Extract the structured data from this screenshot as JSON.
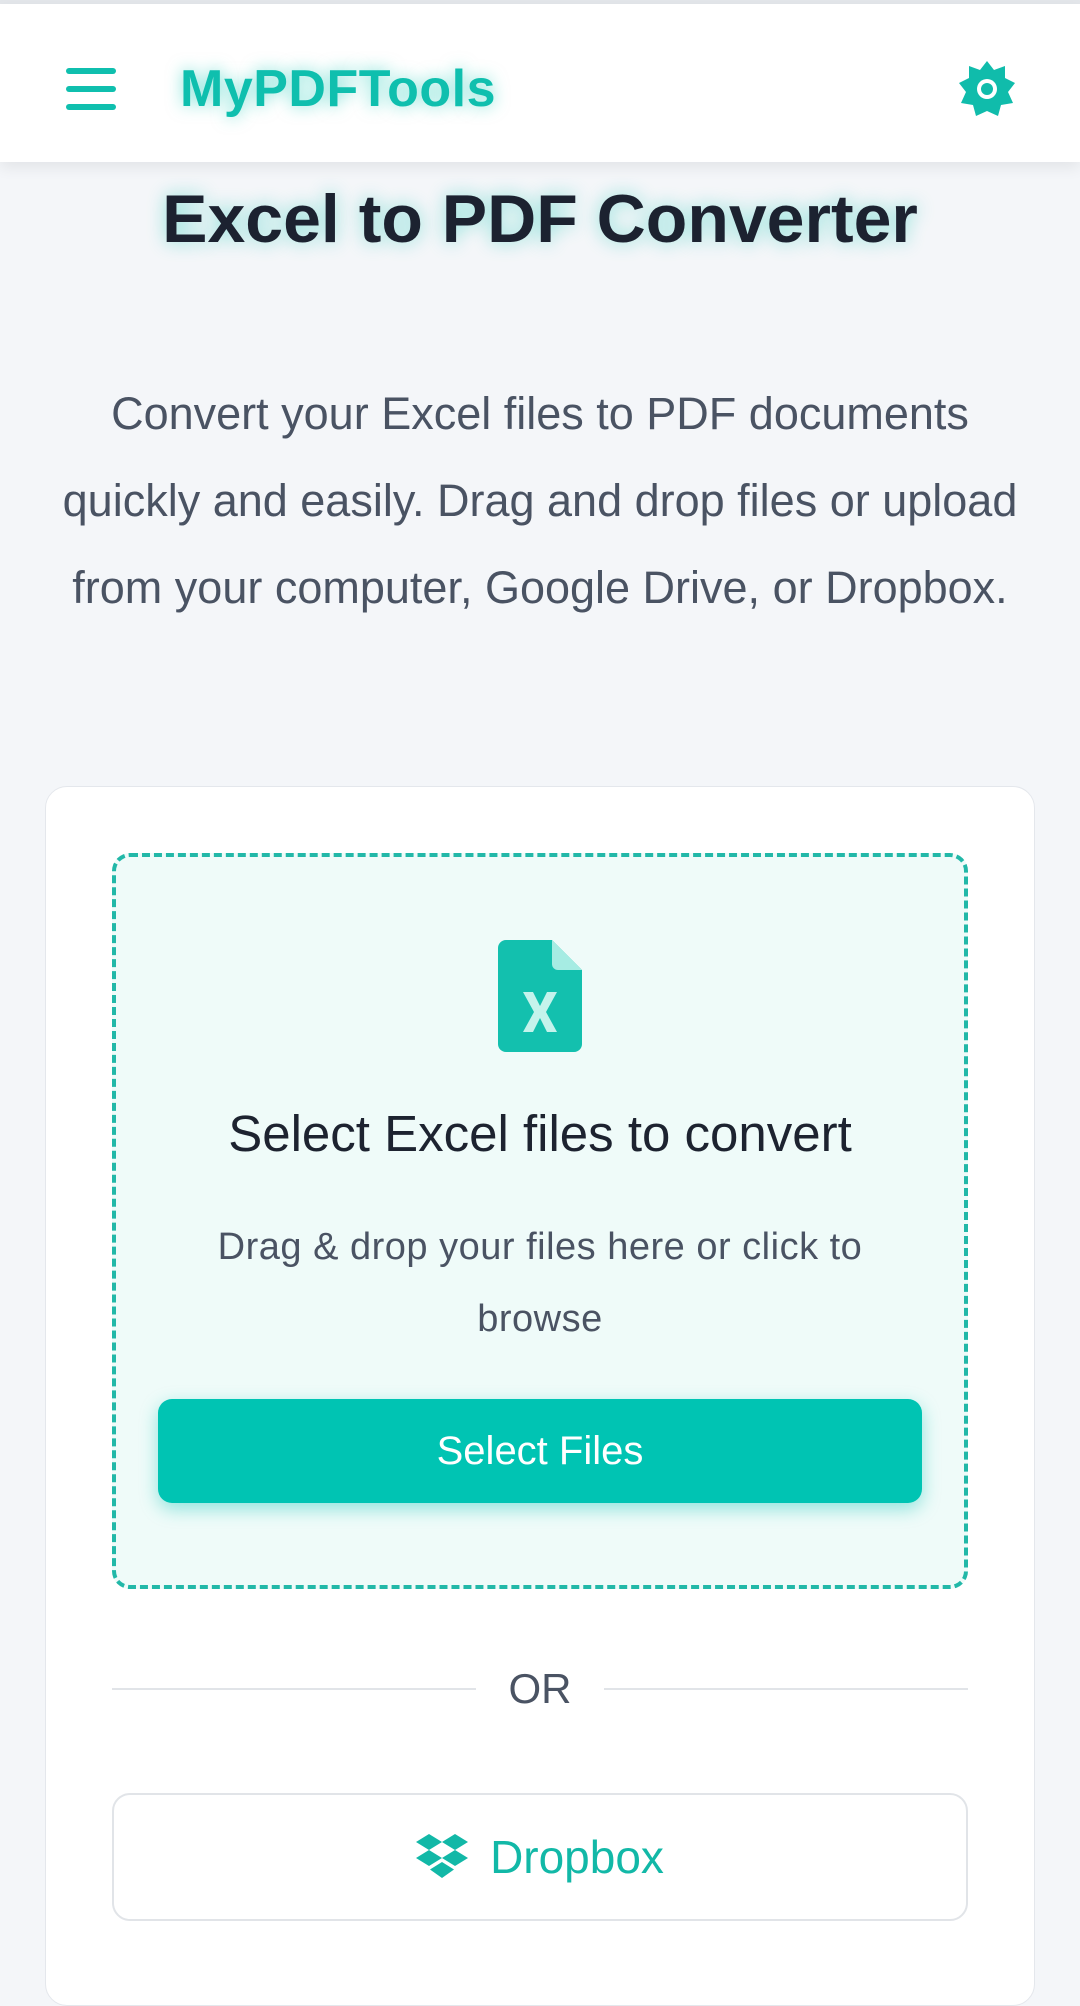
{
  "header": {
    "brand": "MyPDFTools",
    "menu_icon": "hamburger-menu-icon",
    "settings_icon": "gear-icon"
  },
  "main": {
    "title": "Excel to PDF Converter",
    "description": "Convert your Excel files to PDF documents quickly and easily. Drag and drop files or upload from your computer, Google Drive, or Dropbox."
  },
  "upload": {
    "file_icon": "excel-file-icon",
    "title": "Select Excel files to convert",
    "subtitle": "Drag & drop your files here or click to browse",
    "select_button": "Select Files",
    "or_label": "OR",
    "dropbox_icon": "dropbox-icon",
    "dropbox_label": "Dropbox"
  },
  "colors": {
    "accent": "#00c4b3",
    "brand": "#0fbfae",
    "background": "#f4f6f9",
    "dropzone_background": "#effbf9"
  }
}
